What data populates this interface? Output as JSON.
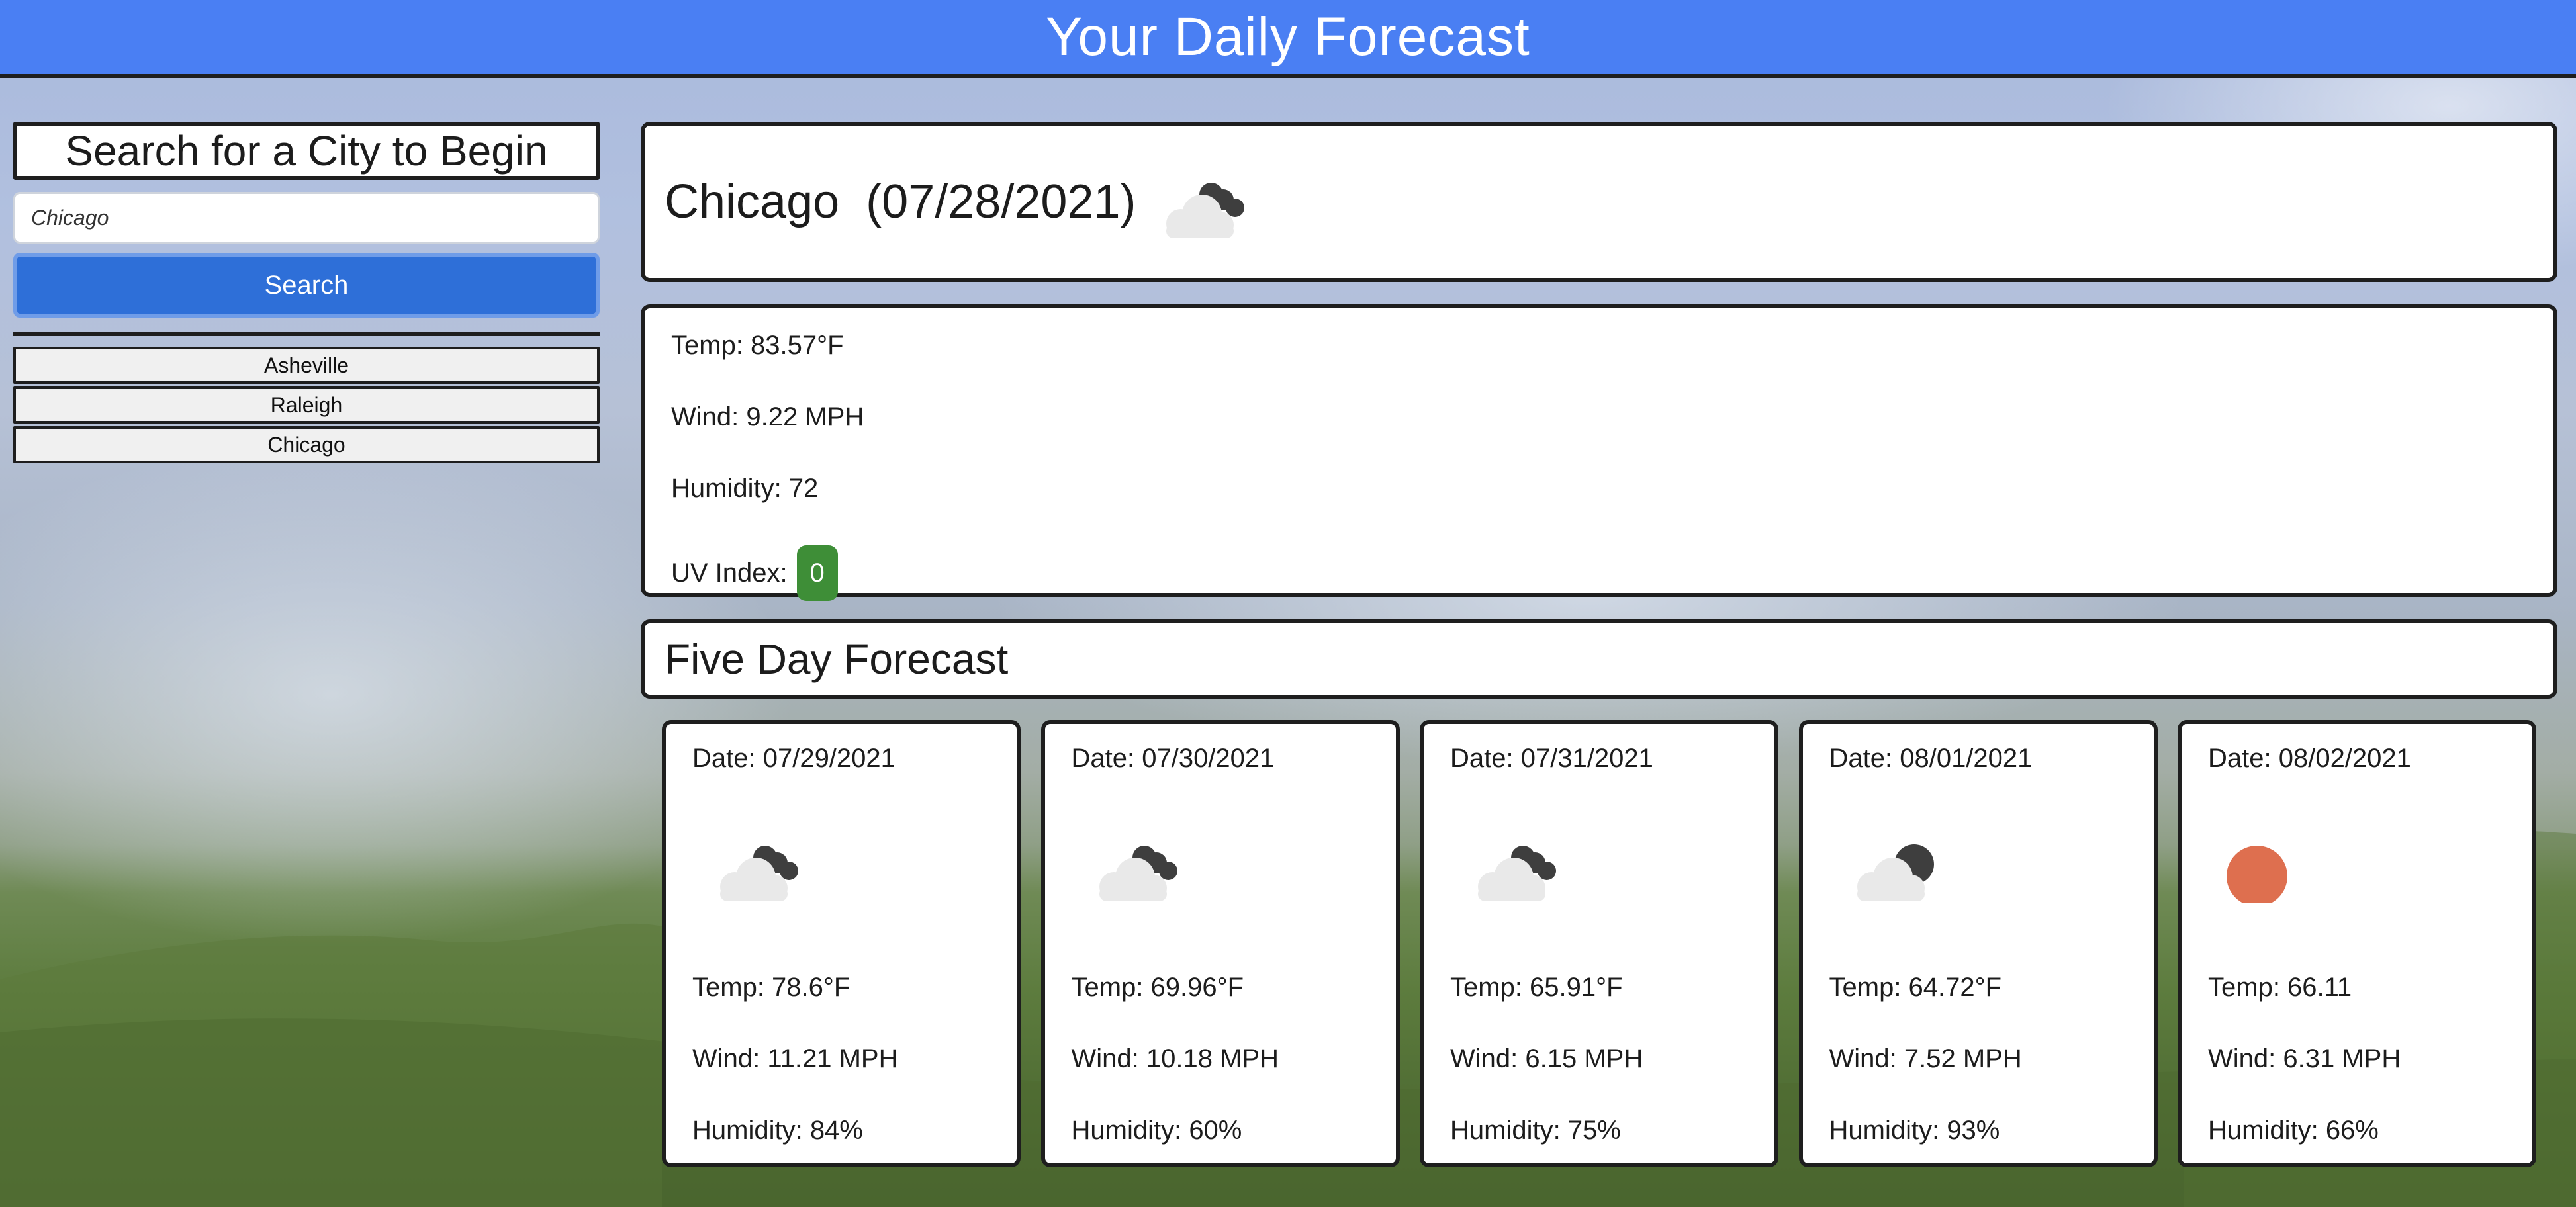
{
  "header": {
    "title": "Your Daily Forecast"
  },
  "search": {
    "title": "Search for a City to Begin",
    "input_value": "Chicago",
    "button_label": "Search"
  },
  "history": [
    "Asheville",
    "Raleigh",
    "Chicago"
  ],
  "current": {
    "title": "Chicago  (07/28/2021)",
    "icon": "partly-cloudy-night-icon",
    "temp": "Temp: 83.57°F",
    "wind": "Wind: 9.22 MPH",
    "humidity": "Humidity: 72",
    "uv_label": "UV Index:",
    "uv_value": "0",
    "uv_color": "#3e8e37"
  },
  "forecast": {
    "title": "Five Day Forecast",
    "days": [
      {
        "date": "Date: 07/29/2021",
        "icon": "partly-cloudy-night-icon",
        "temp": "Temp: 78.6°F",
        "wind": "Wind: 11.21 MPH",
        "humidity": "Humidity: 84%"
      },
      {
        "date": "Date: 07/30/2021",
        "icon": "partly-cloudy-night-icon",
        "temp": "Temp: 69.96°F",
        "wind": "Wind: 10.18 MPH",
        "humidity": "Humidity: 60%"
      },
      {
        "date": "Date: 07/31/2021",
        "icon": "partly-cloudy-night-icon",
        "temp": "Temp: 65.91°F",
        "wind": "Wind: 6.15 MPH",
        "humidity": "Humidity: 75%"
      },
      {
        "date": "Date: 08/01/2021",
        "icon": "cloudy-moon-icon",
        "temp": "Temp: 64.72°F",
        "wind": "Wind: 7.52 MPH",
        "humidity": "Humidity: 93%"
      },
      {
        "date": "Date: 08/02/2021",
        "icon": "clear-sun-icon",
        "temp": "Temp: 66.11",
        "wind": "Wind: 6.31 MPH",
        "humidity": "Humidity: 66%"
      }
    ]
  },
  "colors": {
    "header_bg": "#4a7ff3",
    "search_button": "#2e6fd8",
    "sun": "#de6f4f"
  }
}
